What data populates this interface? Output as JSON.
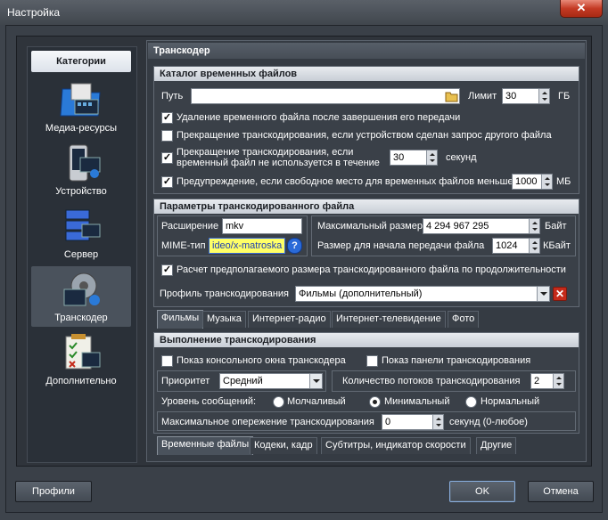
{
  "window": {
    "title": "Настройка",
    "close_symbol": "✕"
  },
  "sidebar": {
    "header": "Категории",
    "items": [
      {
        "label": "Медиа-ресурсы",
        "icon": "media-resources-icon",
        "selected": false
      },
      {
        "label": "Устройство",
        "icon": "device-icon",
        "selected": false
      },
      {
        "label": "Сервер",
        "icon": "server-icon",
        "selected": false
      },
      {
        "label": "Транскодер",
        "icon": "transcoder-icon",
        "selected": true
      },
      {
        "label": "Дополнительно",
        "icon": "additional-icon",
        "selected": false
      }
    ]
  },
  "panel": {
    "title": "Транскодер",
    "temp_catalog": {
      "header": "Каталог временных файлов",
      "path_label": "Путь",
      "path_value": "",
      "limit_label": "Лимит",
      "limit_value": "30",
      "limit_unit": "ГБ",
      "opt_delete": {
        "label": "Удаление временного файла после завершения его передачи",
        "checked": true
      },
      "opt_stop": {
        "label": "Прекращение транскодирования, если устройством сделан запрос другого файла",
        "checked": false
      },
      "opt_stop_unused": {
        "label_line1": "Прекращение транскодирования, если",
        "label_line2": "временный файл не используется в течение",
        "checked": true,
        "value": "30",
        "unit": "секунд"
      },
      "opt_warn": {
        "label": "Предупреждение, если свободное место для временных файлов меньше",
        "checked": true,
        "value": "1000",
        "unit": "МБ"
      }
    },
    "params": {
      "header": "Параметры транскодированного файла",
      "ext_label": "Расширение",
      "ext_value": "mkv",
      "mime_label": "MIME-тип",
      "mime_value": "ideo/x-matroska",
      "max_size_label": "Максимальный размер",
      "max_size_value": "4 294 967 295",
      "max_size_unit": "Байт",
      "start_size_label": "Размер для начала передачи файла",
      "start_size_value": "1024",
      "start_size_unit": "КБайт",
      "opt_estimate": {
        "label": "Расчет предполагаемого размера транскодированного файла по продолжительности",
        "checked": true
      },
      "profile_label": "Профиль транскодирования",
      "profile_value": "Фильмы (дополнительный)"
    },
    "profile_tabs": [
      "Фильмы",
      "Музыка",
      "Интернет-радио",
      "Интернет-телевидение",
      "Фото"
    ],
    "execution": {
      "header": "Выполнение транскодирования",
      "opt_console": {
        "label": "Показ консольного окна транскодера",
        "checked": false
      },
      "opt_panel": {
        "label": "Показ панели транскодирования",
        "checked": false
      },
      "priority_label": "Приоритет",
      "priority_value": "Средний",
      "threads_label": "Количество потоков транскодирования",
      "threads_value": "2",
      "log_label": "Уровень сообщений:",
      "log_options": [
        {
          "label": "Молчаливый",
          "checked": false
        },
        {
          "label": "Минимальный",
          "checked": true
        },
        {
          "label": "Нормальный",
          "checked": false
        }
      ],
      "lead_label": "Максимальное опережение транскодирования",
      "lead_value": "0",
      "lead_unit": "секунд (0-любое)"
    },
    "bottom_tabs": [
      "Временные файлы",
      "Кодеки, кадр",
      "Субтитры, индикатор скорости",
      "Другие"
    ]
  },
  "footer": {
    "profiles_label": "Профили",
    "ok_label": "OK",
    "cancel_label": "Отмена"
  },
  "colors": {
    "accent_highlight": "#ffff66",
    "close_red": "#c43a24"
  }
}
